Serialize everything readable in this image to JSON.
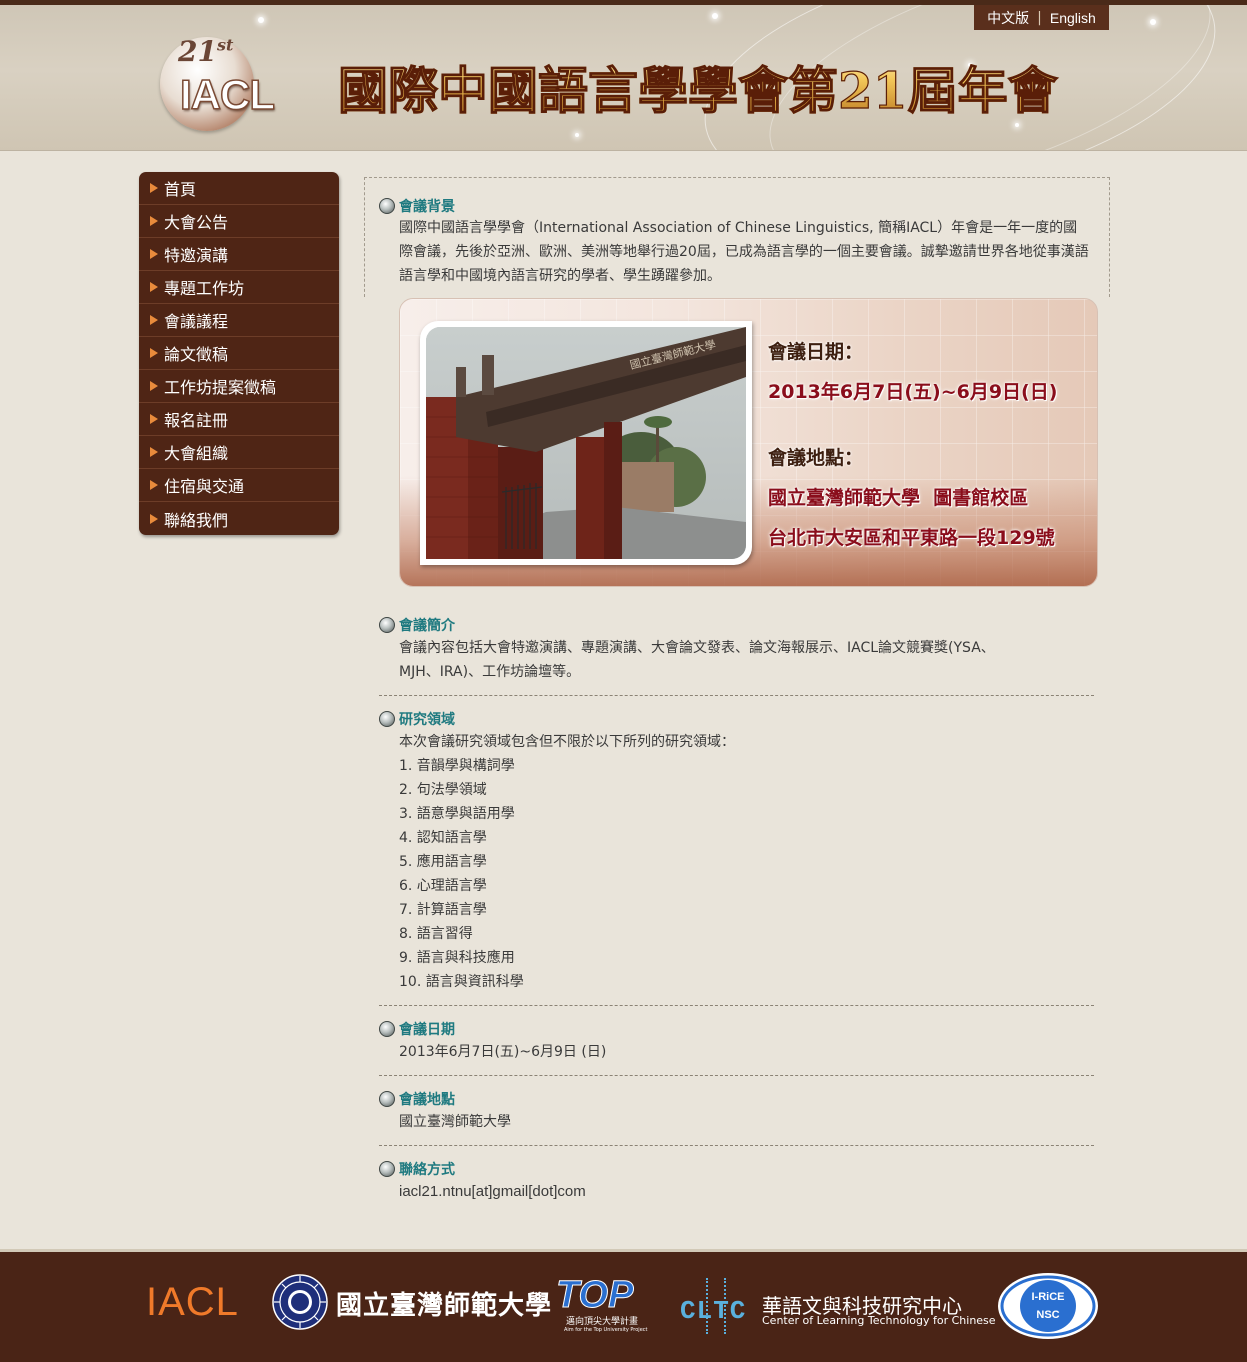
{
  "header": {
    "lang_zh": "中文版",
    "lang_sep": "|",
    "lang_en": "English",
    "logo_number": "21",
    "logo_suffix": "st",
    "logo_word": "IACL",
    "title": "國際中國語言學學會第21屆年會"
  },
  "sidebar": {
    "items": [
      {
        "label": "首頁"
      },
      {
        "label": "大會公告"
      },
      {
        "label": "特邀演講"
      },
      {
        "label": "專題工作坊"
      },
      {
        "label": "會議議程"
      },
      {
        "label": "論文徵稿"
      },
      {
        "label": "工作坊提案徵稿"
      },
      {
        "label": "報名註冊"
      },
      {
        "label": "大會組織"
      },
      {
        "label": "住宿與交通"
      },
      {
        "label": "聯絡我們"
      }
    ]
  },
  "main": {
    "background": {
      "title": "會議背景",
      "text": "國際中國語言學學會（International Association of Chinese Linguistics, 簡稱IACL）年會是一年一度的國際會議，先後於亞洲、歐洲、美洲等地舉行過20屆，已成為語言學的一個主要會議。誠摯邀請世界各地從事漢語語言學和中國境內語言研究的學者、學生踴躍參加。"
    },
    "banner": {
      "date_label": "會議日期：",
      "date_value": "2013年6月7日(五)~6月9日(日)",
      "venue_label": "會議地點：",
      "venue_line1": "國立臺灣師範大學  圖書館校區",
      "venue_line2": "台北市大安區和平東路一段129號",
      "photo_sign": "國立臺灣師範大學"
    },
    "intro": {
      "title": "會議簡介",
      "line1": "會議內容包括大會特邀演講、專題演講、大會論文發表、論文海報展示、IACL論文競賽獎(YSA、",
      "line2": "MJH、IRA)、工作坊論壇等。"
    },
    "fields": {
      "title": "研究領域",
      "lead": "本次會議研究領域包含但不限於以下所列的研究領域：",
      "items": [
        "1. 音韻學與構詞學",
        "2. 句法學領域",
        "3. 語意學與語用學",
        "4. 認知語言學",
        "5. 應用語言學",
        "6. 心理語言學",
        "7. 計算語言學",
        "8. 語言習得",
        "9. 語言與科技應用",
        "10. 語言與資訊科學"
      ]
    },
    "date": {
      "title": "會議日期",
      "value": "2013年6月7日(五)~6月9日 (日)"
    },
    "venue": {
      "title": "會議地點",
      "value": "國立臺灣師範大學"
    },
    "contact": {
      "title": "聯絡方式",
      "value": "iacl21.ntnu[at]gmail[dot]com"
    }
  },
  "footer": {
    "iacl": "IACL",
    "ntnu": "國立臺灣師範大學",
    "top": "TOP",
    "top_cn": "邁向頂尖大學計畫",
    "top_en": "Aim for the Top University Project",
    "cltc_logo": "CLTC",
    "cltc_cn": "華語文與科技研究中心",
    "cltc_en": "Center of Learning Technology for Chinese",
    "irice": "I-RiCE",
    "nsc": "NSC"
  },
  "colors": {
    "nav_bg": "#4f2515",
    "section_title": "#1f7a80",
    "banner_red": "#8a0d1b",
    "footer_bg": "#4a2416",
    "iacl_orange": "#f07a2a"
  }
}
